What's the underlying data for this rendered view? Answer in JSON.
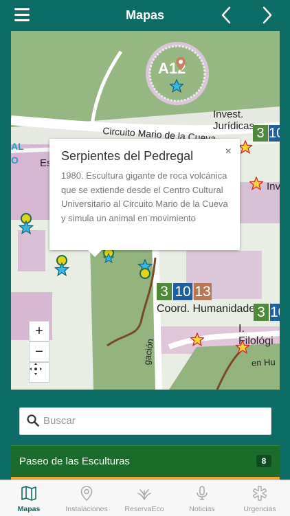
{
  "header": {
    "title": "Mapas"
  },
  "map": {
    "labels": {
      "building_code": "A12",
      "invest_juridicas": "Invest. Jurídicas",
      "circuito": "Circuito Mario de la Cueva",
      "coord_humanidades": "Coord. Humanidades",
      "filologia": "I. Filológi",
      "inv_short": "Inv",
      "es_short": "Es",
      "al_short": "AL",
      "o_short": "O",
      "en_hum": "en Hu",
      "gacion": "gación"
    },
    "route_numbers": [
      "3",
      "10",
      "13"
    ],
    "zoom_in": "+",
    "zoom_out": "−"
  },
  "popup": {
    "title": "Serpientes del Pedregal",
    "close": "×",
    "description": "1980. Escultura gigante de roca volcánica que se extiende desde el Centro Cultural Universitario al Circuito Mario de la Cueva y simula un animal en movimiento"
  },
  "search": {
    "placeholder": "Buscar"
  },
  "list": {
    "label": "Paseo de las Esculturas",
    "count": "8"
  },
  "tabs": [
    {
      "label": "Mapas",
      "icon": "map-icon",
      "active": true
    },
    {
      "label": "Instalaciones",
      "icon": "location-pin-icon"
    },
    {
      "label": "ReservaEco",
      "icon": "plant-icon"
    },
    {
      "label": "Noticias",
      "icon": "microphone-icon"
    },
    {
      "label": "Urgencias",
      "icon": "medical-cross-icon"
    }
  ],
  "colors": {
    "header": "#0e6c66",
    "route_3": "#4f8a3c",
    "route_10": "#1f5f9b",
    "route_13": "#b57a55",
    "list_row": "#1b6b2a"
  }
}
